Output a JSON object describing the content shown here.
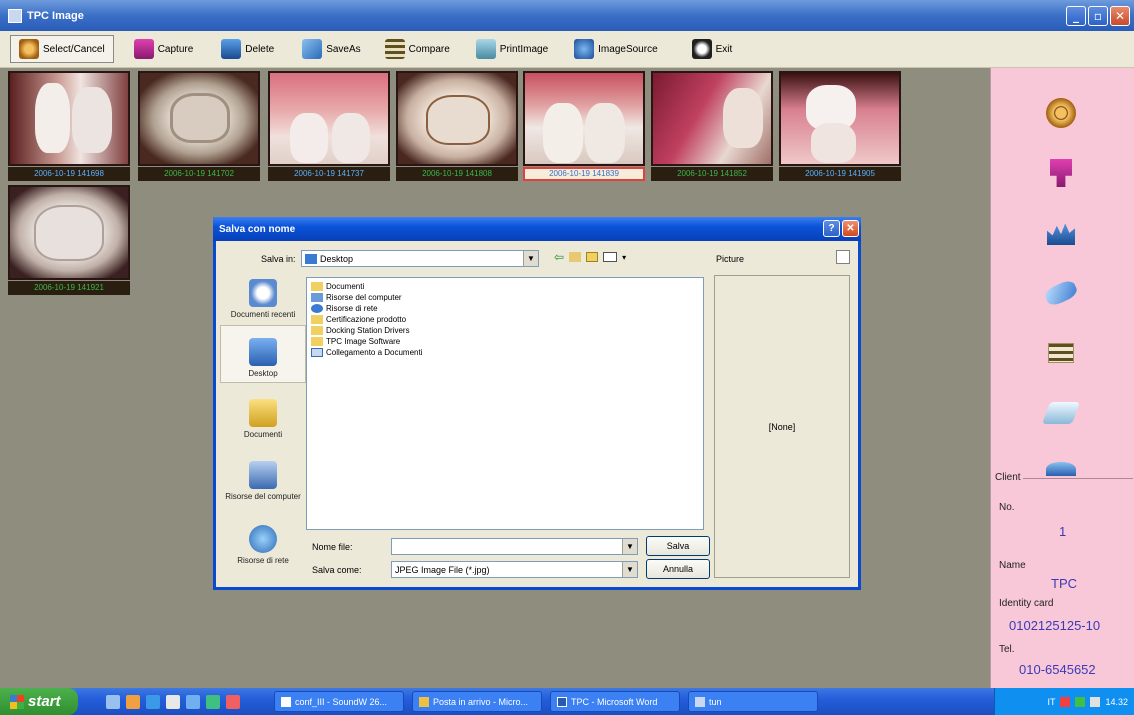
{
  "window": {
    "title": "TPC Image"
  },
  "toolbar": {
    "items": [
      {
        "label": "Select/Cancel",
        "icon": "film-reel-icon",
        "color": "#d08a2a"
      },
      {
        "label": "Capture",
        "icon": "camera-icon",
        "color": "#b03090"
      },
      {
        "label": "Delete",
        "icon": "delete-icon",
        "color": "#2a6ab0"
      },
      {
        "label": "SaveAs",
        "icon": "save-as-icon",
        "color": "#3a7ad0"
      },
      {
        "label": "Compare",
        "icon": "compare-icon",
        "color": "#807040"
      },
      {
        "label": "PrintImage",
        "icon": "print-icon",
        "color": "#4a8aa0"
      },
      {
        "label": "ImageSource",
        "icon": "image-source-icon",
        "color": "#3a7ad0"
      },
      {
        "label": "Exit",
        "icon": "exit-icon",
        "color": "#303030"
      }
    ]
  },
  "thumbnails": [
    {
      "caption": "2006-10-19 141698",
      "style": "blue",
      "selected": false
    },
    {
      "caption": "2006-10-19 141702",
      "style": "green",
      "selected": false
    },
    {
      "caption": "2006-10-19 141737",
      "style": "blue",
      "selected": false
    },
    {
      "caption": "2006-10-19 141808",
      "style": "green",
      "selected": false
    },
    {
      "caption": "2006-10-19 141839",
      "style": "blue",
      "selected": true
    },
    {
      "caption": "2006-10-19 141852",
      "style": "green",
      "selected": false
    },
    {
      "caption": "2006-10-19 141905",
      "style": "blue",
      "selected": false
    },
    {
      "caption": "2006-10-19 141921",
      "style": "green",
      "selected": false
    }
  ],
  "client": {
    "heading": "Client",
    "no_label": "No.",
    "no_value": "1",
    "name_label": "Name",
    "name_value": "TPC",
    "id_label": "Identity card",
    "id_value": "0102125125-10",
    "tel_label": "Tel.",
    "tel_value": "010-6545652"
  },
  "dialog": {
    "title": "Salva con nome",
    "save_in_label": "Salva in:",
    "save_in_value": "Desktop",
    "preview_label": "Picture",
    "preview_text": "[None]",
    "places": [
      "Documenti recenti",
      "Desktop",
      "Documenti",
      "Risorse del computer",
      "Risorse di rete"
    ],
    "files": [
      {
        "name": "Documenti",
        "icon": "folder"
      },
      {
        "name": "Risorse del computer",
        "icon": "computer"
      },
      {
        "name": "Risorse di rete",
        "icon": "network"
      },
      {
        "name": "Certificazione prodotto",
        "icon": "folder"
      },
      {
        "name": "Docking Station Drivers",
        "icon": "folder"
      },
      {
        "name": "TPC Image Software",
        "icon": "folder"
      },
      {
        "name": "Collegamento a Documenti",
        "icon": "shortcut"
      }
    ],
    "filename_label": "Nome file:",
    "filename_value": "",
    "filetype_label": "Salva come:",
    "filetype_value": "JPEG Image File (*.jpg)",
    "save_button": "Salva",
    "cancel_button": "Annulla"
  },
  "taskbar": {
    "start": "start",
    "tasks": [
      "conf_III - SoundW 26...",
      "Posta in arrivo - Micro...",
      "TPC - Microsoft Word",
      "tun"
    ],
    "clock": "14.32",
    "lang": "IT"
  }
}
